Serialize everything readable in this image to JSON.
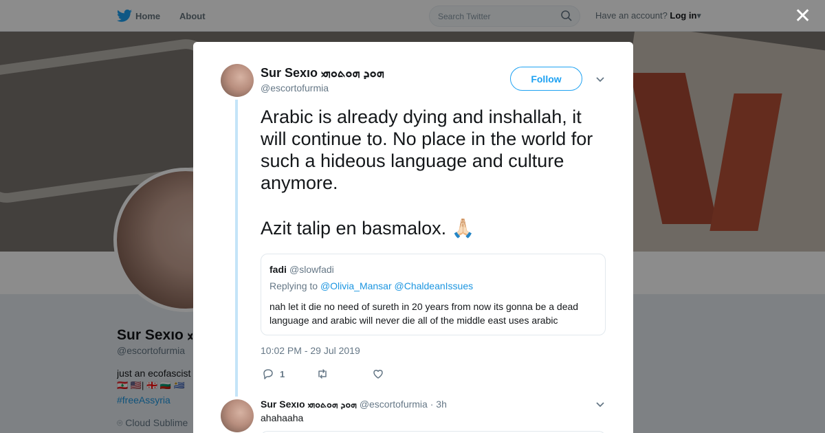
{
  "nav": {
    "home_label": "Home",
    "about_label": "About",
    "search_placeholder": "Search Twitter",
    "account_prompt": "Have an account?",
    "login_label": "Log in"
  },
  "profile": {
    "name": "Sur Sexıo ܗܘܕ ܗܘܬܘܗܝ",
    "handle": "@escortofurmia",
    "bio": "just an ecofascist",
    "flags": "🇱🇧 🇺🇸| 🇬🇪 🇧🇬 🇺🇾",
    "hashtag": "#freeAssyria",
    "location": "Cloud Sublime"
  },
  "tweet": {
    "author_name": "Sur Sexıo ܗܘܕ ܗܘܬܘܗܝ",
    "author_handle": "@escortofurmia",
    "follow_label": "Follow",
    "text_line1": "Arabic is already dying and inshallah, it will continue to. No place in the world for such a hideous language and culture anymore.",
    "text_line2": "Azit talip en basmalox. 🙏🏻",
    "quote": {
      "name": "fadi",
      "handle": "@slowfadi",
      "replying_prefix": "Replying to",
      "mention1": "@Olivia_Mansar",
      "mention2": "@ChaldeanIssues",
      "text": "nah let it die no need of sureth in 20 years from now its gonna be a dead language and arabic will never die all of the middle east uses arabic"
    },
    "timestamp": "10:02 PM - 29 Jul 2019",
    "reply_count": "1",
    "retweet_count": "",
    "like_count": ""
  },
  "reply": {
    "author_name": "Sur Sexıo ܗܘܕ ܗܘܬܘܗܝ",
    "author_handle": "@escortofurmia",
    "age": "· 3h",
    "text": "ahahaaha"
  },
  "colors": {
    "accent": "#1da1f2",
    "link": "#1b95e0",
    "thread_line": "#c4e4f8",
    "muted": "#657786"
  }
}
